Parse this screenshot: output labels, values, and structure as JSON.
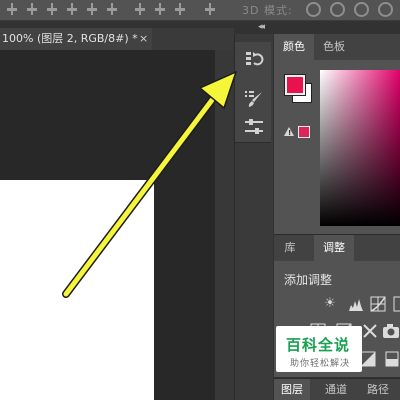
{
  "options_bar": {
    "mode_label": "3D 模式:"
  },
  "document_tab": {
    "title": "100% (图层 2, RGB/8#) *",
    "close_glyph": "×"
  },
  "collapse_glyph": "◂◂",
  "color_panel": {
    "tabs": [
      "颜色",
      "色板"
    ],
    "active_tab": "颜色",
    "foreground_color": "#e8124d",
    "background_color": "#ffffff",
    "gamut_color": "#e0245a",
    "field_hue": "#e3006a"
  },
  "adjustments_panel": {
    "tabs": [
      "库",
      "调整"
    ],
    "active_tab": "调整",
    "title": "添加调整"
  },
  "layers_panel": {
    "tabs": [
      "图层",
      "通道",
      "路径"
    ],
    "active_tab": "图层"
  },
  "watermark": {
    "title": "百科全说",
    "subtitle": "助你轻松解决"
  },
  "annotation": {
    "color": "#f5f53a",
    "shape": "arrow"
  },
  "icons": {
    "dock": [
      "history-icon",
      "brush-presets-icon",
      "properties-icon"
    ],
    "adjustments": [
      "brightness-icon",
      "levels-icon",
      "curves-icon",
      "exposure-icon",
      "vibrance-icon",
      "hue-saturation-icon",
      "color-balance-icon",
      "black-white-icon",
      "photo-filter-icon",
      "invert-icon",
      "posterize-icon",
      "threshold-icon"
    ]
  }
}
